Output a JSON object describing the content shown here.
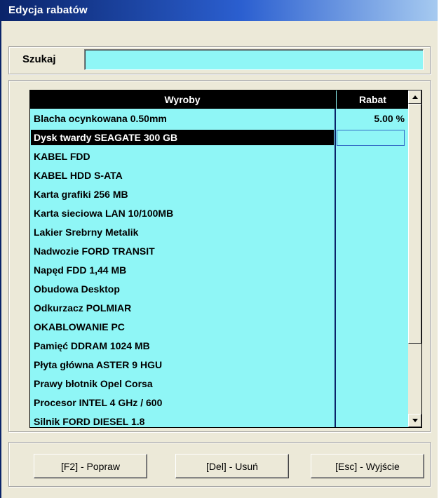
{
  "window": {
    "title": "Edycja rabatów"
  },
  "search": {
    "label": "Szukaj",
    "value": ""
  },
  "table": {
    "columns": {
      "product": "Wyroby",
      "discount": "Rabat"
    },
    "rows": [
      {
        "name": "Blacha ocynkowana 0.50mm",
        "discount": "5.00 %"
      },
      {
        "name": "Dysk twardy SEAGATE 300 GB",
        "discount": ""
      },
      {
        "name": "KABEL FDD",
        "discount": ""
      },
      {
        "name": "KABEL HDD S-ATA",
        "discount": ""
      },
      {
        "name": "Karta grafiki 256 MB",
        "discount": ""
      },
      {
        "name": "Karta sieciowa LAN 10/100MB",
        "discount": ""
      },
      {
        "name": "Lakier Srebrny Metalik",
        "discount": ""
      },
      {
        "name": "Nadwozie FORD TRANSIT",
        "discount": ""
      },
      {
        "name": "Napęd FDD 1,44 MB",
        "discount": ""
      },
      {
        "name": "Obudowa Desktop",
        "discount": ""
      },
      {
        "name": "Odkurzacz POLMIAR",
        "discount": ""
      },
      {
        "name": "OKABLOWANIE PC",
        "discount": ""
      },
      {
        "name": "Pamięć DDRAM 1024 MB",
        "discount": ""
      },
      {
        "name": "Płyta główna ASTER 9 HGU",
        "discount": ""
      },
      {
        "name": "Prawy błotnik Opel Corsa",
        "discount": ""
      },
      {
        "name": "Procesor INTEL 4 GHz / 600",
        "discount": ""
      },
      {
        "name": "Silnik FORD DIESEL 1.8",
        "discount": ""
      }
    ],
    "selected_row": "Dysk twardy SEAGATE 300 GB"
  },
  "buttons": {
    "edit": "[F2] - Popraw",
    "delete": "[Del] - Usuń",
    "exit": "[Esc] - Wyjście"
  },
  "colors": {
    "title_bar": "#0a246a",
    "grid_background": "#8ff6f6",
    "grid_header": "#000000",
    "window_background": "#ece9d8"
  }
}
